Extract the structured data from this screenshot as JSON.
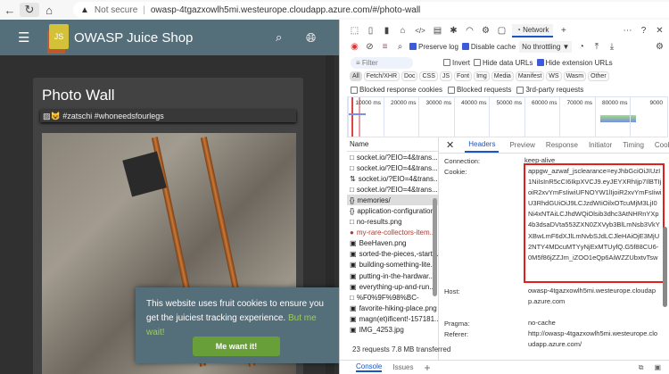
{
  "browser": {
    "not_secure": "Not secure",
    "url": "owasp-4tgazxowlh5mi.westeurope.cloudapp.azure.com/#/photo-wall"
  },
  "app": {
    "title": "OWASP Juice Shop",
    "page_title": "Photo Wall",
    "caption": "#zatschi #whoneedsfourlegs",
    "cookie_text": "This website uses fruit cookies to ensure you get the juiciest tracking experience.",
    "cookie_link": "But me wait!",
    "cookie_button": "Me want it!"
  },
  "devtools": {
    "active_tab": "Network",
    "preserve_log": "Preserve log",
    "disable_cache": "Disable cache",
    "throttling": "No throttling",
    "filter_placeholder": "Filter",
    "invert": "Invert",
    "hide_data_urls": "Hide data URLs",
    "hide_ext_urls": "Hide extension URLs",
    "types": [
      "All",
      "Fetch/XHR",
      "Doc",
      "CSS",
      "JS",
      "Font",
      "Img",
      "Media",
      "Manifest",
      "WS",
      "Wasm",
      "Other"
    ],
    "blocked_cookies": "Blocked response cookies",
    "blocked_requests": "Blocked requests",
    "third_party": "3rd-party requests",
    "ticks": [
      "10000 ms",
      "20000 ms",
      "30000 ms",
      "40000 ms",
      "50000 ms",
      "60000 ms",
      "70000 ms",
      "80000 ms",
      "9000"
    ],
    "name_header": "Name",
    "requests": [
      {
        "name": "socket.io/?EIO=4&trans...",
        "icon": "□"
      },
      {
        "name": "socket.io/?EIO=4&trans...",
        "icon": "□"
      },
      {
        "name": "socket.io/?EIO=4&trans...",
        "icon": "⇅"
      },
      {
        "name": "socket.io/?EIO=4&trans...",
        "icon": "□"
      },
      {
        "name": "memories/",
        "icon": "{}"
      },
      {
        "name": "application-configuration",
        "icon": "{}"
      },
      {
        "name": "no-results.png",
        "icon": "□"
      },
      {
        "name": "my-rare-collectors-item...",
        "icon": "●"
      },
      {
        "name": "BeeHaven.png",
        "icon": "▣"
      },
      {
        "name": "sorted-the-pieces,-start...",
        "icon": "▣"
      },
      {
        "name": "building-something-lite...",
        "icon": "▣"
      },
      {
        "name": "putting-in-the-hardwar...",
        "icon": "▣"
      },
      {
        "name": "everything-up-and-run...",
        "icon": "▣"
      },
      {
        "name": "%F0%9F%98%BC-",
        "icon": "□"
      },
      {
        "name": "favorite-hiking-place.png",
        "icon": "▣"
      },
      {
        "name": "magn(et)ificent!-157181...",
        "icon": "▣"
      },
      {
        "name": "IMG_4253.jpg",
        "icon": "▣"
      }
    ],
    "status": "23 requests  7.8 MB transferred",
    "detail_tabs": [
      "Headers",
      "Preview",
      "Response",
      "Initiator",
      "Timing",
      "Cookies"
    ],
    "headers": {
      "connection_k": "Connection:",
      "connection_v": "keep-alive",
      "cookie_k": "Cookie:",
      "cookie_v": "appgw_azwaf_jsclearance=eyJhbGciOiJIUzI1NiIsInR5cCI6IkpXVCJ9.eyJEYXRhIjp7IlBTIjoiR2xvYmFsIiwiUFNOYW1lIjoiR2xvYmFsIiwiU3RhdGUiOiJ9LCJzdWIiOilxOTcuMjM3LjI0Ni4xNTAiLCJhdWQiOlsib3dhc3AtNHRnYXp4b3dsaDVta553ZXN0ZXVyb3BlLmNsb3VkYXBwLmF6dXJlLmNvbSJdLCJleHAiOjE3MjU2NTY4MDcuMTYyNjExMTUyfQ.G5f88CU6-0M5f86jZZJm_iZOO1eQp6AiWZZUbxtvTsw",
      "host_k": "Host:",
      "host_v": "owasp-4tgazxowlh5mi.westeurope.cloudapp.azure.com",
      "pragma_k": "Pragma:",
      "pragma_v": "no-cache",
      "referer_k": "Referer:",
      "referer_v": "http://owasp-4tgazxowlh5mi.westeurope.cloudapp.azure.com/"
    },
    "bottom_tabs": [
      "Console",
      "Issues"
    ]
  }
}
